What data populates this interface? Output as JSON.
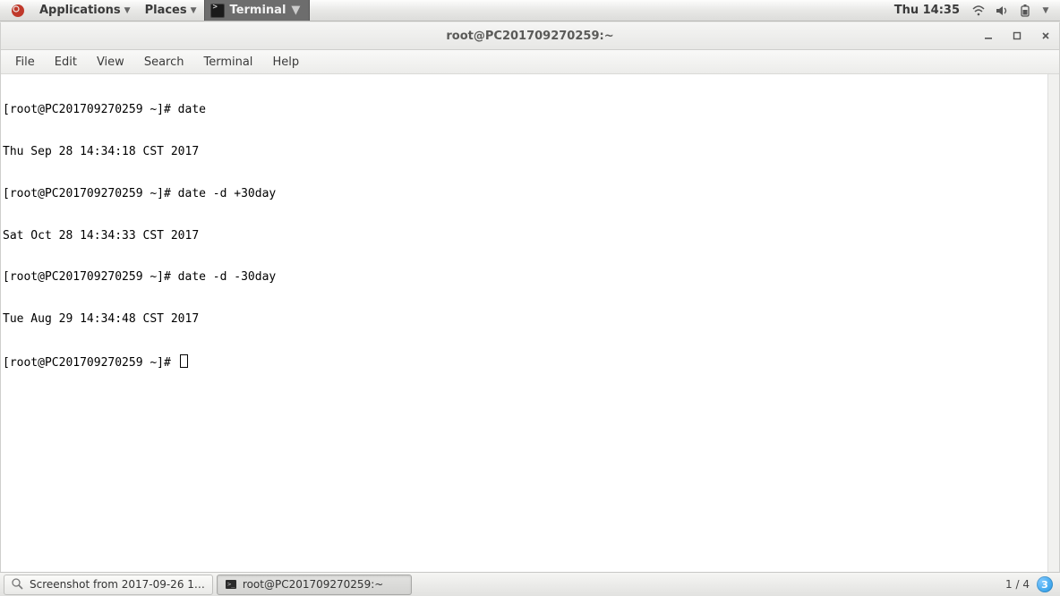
{
  "top_panel": {
    "applications_label": "Applications",
    "places_label": "Places",
    "running_app_label": "Terminal",
    "clock": "Thu 14:35"
  },
  "window": {
    "title": "root@PC201709270259:~",
    "menu": {
      "file": "File",
      "edit": "Edit",
      "view": "View",
      "search": "Search",
      "terminal": "Terminal",
      "help": "Help"
    }
  },
  "terminal": {
    "prompt": "[root@PC201709270259 ~]# ",
    "lines": [
      "[root@PC201709270259 ~]# date",
      "Thu Sep 28 14:34:18 CST 2017",
      "[root@PC201709270259 ~]# date -d +30day",
      "Sat Oct 28 14:34:33 CST 2017",
      "[root@PC201709270259 ~]# date -d -30day",
      "Tue Aug 29 14:34:48 CST 2017"
    ]
  },
  "bottom_panel": {
    "task1_label": "Screenshot from 2017-09-26 1…",
    "task2_label": "root@PC201709270259:~",
    "workspace": "1 / 4",
    "notif_count": "3"
  }
}
